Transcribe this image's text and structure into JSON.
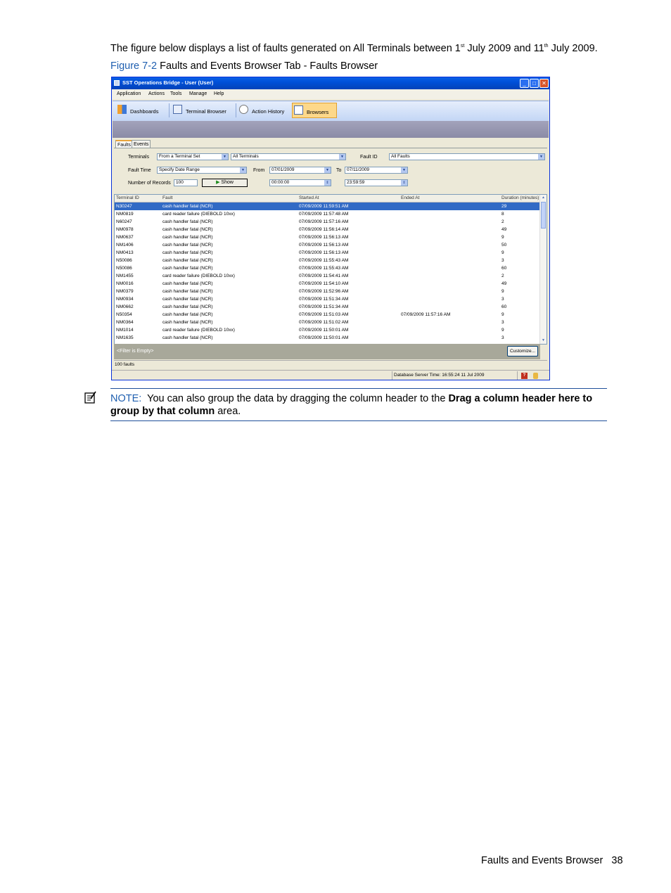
{
  "intro": {
    "pre": "The figure below displays a list of faults generated on All Terminals between 1",
    "sup1": "st",
    "mid": " July 2009 and 11",
    "sup2": "th",
    "post": " July 2009."
  },
  "caption": {
    "label": "Figure 7-2",
    "text": " Faults and Events Browser Tab - Faults Browser"
  },
  "window": {
    "title": "SST Operations Bridge - User (User)",
    "menu": [
      "Application",
      "Actions",
      "Tools",
      "Manage",
      "Help"
    ],
    "toolbar": [
      "Dashboards",
      "Terminal Browser",
      "Action History",
      "Browsers"
    ],
    "tabs": [
      "Faults",
      "Events"
    ],
    "filters": {
      "terminals_label": "Terminals",
      "terminals_set": "From a Terminal Set",
      "terminals_value": "All Terminals",
      "fault_id_label": "Fault ID",
      "fault_id_value": "All Faults",
      "fault_time_label": "Fault Time",
      "fault_time_value": "Specify Date Range",
      "from_label": "From",
      "from_date": "07/01/2009",
      "to_label": "To",
      "to_date": "07/11/2009",
      "records_label": "Number of Records",
      "records_value": "100",
      "show_label": "Show",
      "from_time": "00:00:00",
      "to_time": "23:59:59"
    },
    "grid": {
      "columns": [
        "Terminal ID",
        "Fault",
        "Started At",
        "Ended At",
        "Duration (minutes)"
      ],
      "rows": [
        [
          "N30247",
          "cash handler fatal (NCR)",
          "07/09/2009 11:59:51 AM",
          "",
          "29"
        ],
        [
          "NM0819",
          "card reader failure (DIEBOLD 10xx)",
          "07/09/2009 11:57:48 AM",
          "",
          "8"
        ],
        [
          "N60247",
          "cash handler fatal (NCR)",
          "07/09/2009 11:57:16 AM",
          "",
          "2"
        ],
        [
          "NM0978",
          "cash handler fatal (NCR)",
          "07/09/2009 11:56:14 AM",
          "",
          "49"
        ],
        [
          "NM0637",
          "cash handler fatal (NCR)",
          "07/09/2009 11:56:13 AM",
          "",
          "9"
        ],
        [
          "NM1406",
          "cash handler fatal (NCR)",
          "07/09/2009 11:56:13 AM",
          "",
          "50"
        ],
        [
          "NM0413",
          "cash handler fatal (NCR)",
          "07/09/2009 11:56:13 AM",
          "",
          "9"
        ],
        [
          "N50086",
          "cash handler fatal (NCR)",
          "07/09/2009 11:55:43 AM",
          "",
          "3"
        ],
        [
          "N50086",
          "cash handler fatal (NCR)",
          "07/09/2009 11:55:43 AM",
          "",
          "60"
        ],
        [
          "NM1455",
          "card reader failure (DIEBOLD 10xx)",
          "07/09/2009 11:54:41 AM",
          "",
          "2"
        ],
        [
          "NM0016",
          "cash handler fatal (NCR)",
          "07/09/2009 11:54:10 AM",
          "",
          "49"
        ],
        [
          "NM0379",
          "cash handler fatal (NCR)",
          "07/09/2009 11:52:96 AM",
          "",
          "9"
        ],
        [
          "NM0934",
          "cash handler fatal (NCR)",
          "07/09/2009 11:51:34 AM",
          "",
          "3"
        ],
        [
          "NM0662",
          "cash handler fatal (NCR)",
          "07/09/2009 11:51:34 AM",
          "",
          "60"
        ],
        [
          "N50354",
          "cash handler fatal (NCR)",
          "07/09/2009 11:51:03 AM",
          "07/09/2009 11:57:16 AM",
          "9"
        ],
        [
          "NM0364",
          "cash handler fatal (NCR)",
          "07/09/2009 11:51:02 AM",
          "",
          "3"
        ],
        [
          "NM1014",
          "card reader failure (DIEBOLD 10xx)",
          "07/09/2009 11:50:01 AM",
          "",
          "9"
        ],
        [
          "NM1635",
          "cash handler fatal (NCR)",
          "07/09/2009 11:50:01 AM",
          "",
          "3"
        ]
      ]
    },
    "filter_text": "<Filter is Empty>",
    "customize_label": "Customize...",
    "count_text": "100 faults",
    "status_text": "Database Server Time: 16:55:24 11 Jul 2009"
  },
  "note": {
    "label": "NOTE:",
    "pre": "You can also group the data by dragging the column header to the ",
    "bold": "Drag a column header here to group by that column",
    "post": " area."
  },
  "footer": {
    "section": "Faults and Events Browser",
    "page": "38"
  }
}
